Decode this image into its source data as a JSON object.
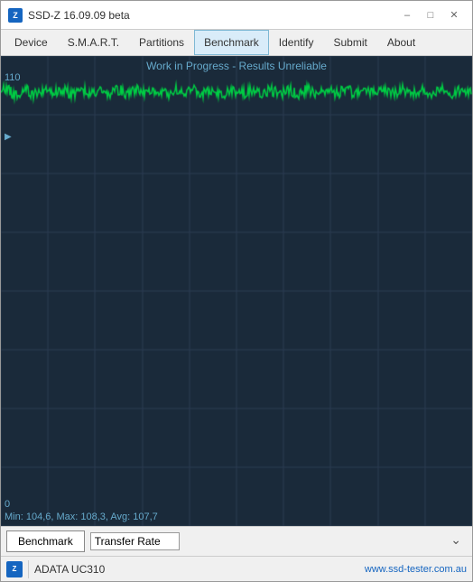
{
  "window": {
    "title": "SSD-Z 16.09.09 beta",
    "icon_label": "Z"
  },
  "window_controls": {
    "minimize": "–",
    "maximize": "□",
    "close": "✕"
  },
  "menu": {
    "items": [
      "Device",
      "S.M.A.R.T.",
      "Partitions",
      "Benchmark",
      "Identify",
      "Submit",
      "About"
    ],
    "active": "Benchmark"
  },
  "chart": {
    "title": "Work in Progress - Results Unreliable",
    "y_max": "110",
    "y_min": "0",
    "stats": "Min: 104,6, Max: 108,3, Avg: 107,7",
    "bg_color": "#1a2a3a",
    "grid_color": "#2a3d52",
    "line_color": "#00cc44"
  },
  "bottom": {
    "bench_label": "Benchmark",
    "select_label": "Transfer Rate",
    "select_arrow": "⌄"
  },
  "status": {
    "icon_label": "Z",
    "device_name": "ADATA UC310",
    "url": "www.ssd-tester.com.au"
  }
}
